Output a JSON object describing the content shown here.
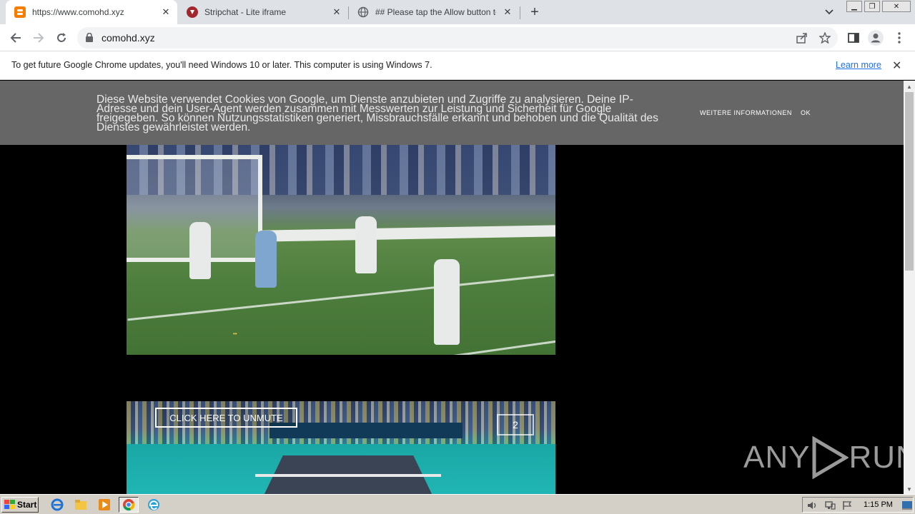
{
  "tabs": [
    {
      "title": "https://www.comohd.xyz",
      "icon": "blogger-icon",
      "active": true
    },
    {
      "title": "Stripchat - Lite iframe",
      "icon": "stripchat-icon",
      "active": false
    },
    {
      "title": "## Please tap the Allow button to c",
      "icon": "globe-icon",
      "active": false
    }
  ],
  "toolbar": {
    "url": "comohd.xyz"
  },
  "infobar": {
    "message": "To get future Google Chrome updates, you'll need Windows 10 or later. This computer is using Windows 7.",
    "learn_more": "Learn more"
  },
  "cookie_banner": {
    "text": "Diese Website verwendet Cookies von Google, um Dienste anzubieten und Zugriffe zu analysieren. Deine IP-Adresse und dein User-Agent werden zusammen mit Messwerten zur Leistung und Sicherheit für Google freigegeben. So können Nutzungsstatistiken generiert, Missbrauchsfälle erkannt und behoben und die Qualität des Dienstes gewährleistet werden.",
    "more_info": "WEITERE INFORMATIONEN",
    "ok": "OK"
  },
  "video2": {
    "unmute_label": "CLICK HERE TO UNMUTE",
    "channel_logo": "2"
  },
  "watermark": {
    "left": "ANY",
    "right": "RUN"
  },
  "taskbar": {
    "start_label": "Start",
    "clock": "1:15 PM"
  },
  "colors": {
    "tabstrip": "#dee1e6",
    "link": "#1a73e8",
    "cookie_bg": "#696969"
  }
}
